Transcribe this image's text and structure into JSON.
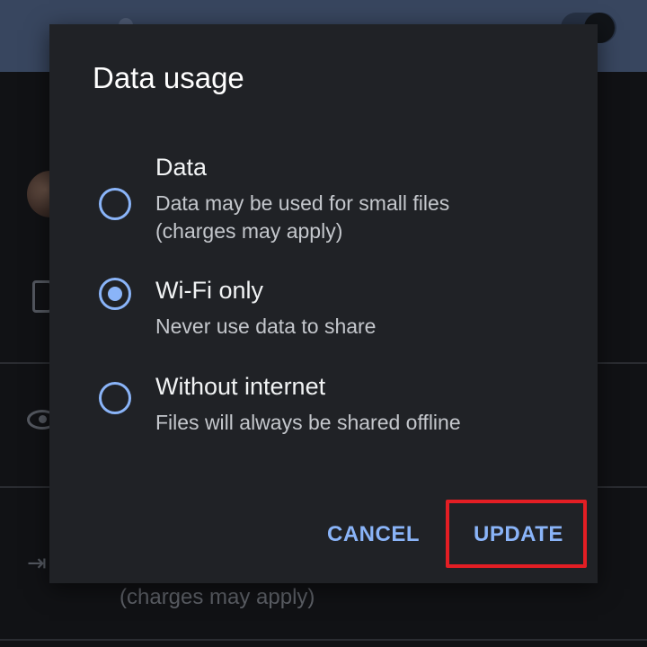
{
  "background": {
    "subtext": "(charges may apply)"
  },
  "dialog": {
    "title": "Data usage",
    "options": [
      {
        "title": "Data",
        "desc_line1": "Data may be used for small files",
        "desc_line2": "(charges may apply)",
        "selected": false
      },
      {
        "title": "Wi-Fi only",
        "desc_line1": "Never use data to share",
        "selected": true
      },
      {
        "title": "Without internet",
        "desc_line1": "Files will always be shared offline",
        "selected": false
      }
    ],
    "buttons": {
      "cancel": "CANCEL",
      "update": "UPDATE"
    }
  },
  "colors": {
    "accent": "#8ab4f8",
    "dialog_bg": "#202226",
    "highlight": "#e31e24",
    "appbar": "#38465f"
  },
  "icons": {
    "background": [
      "avatar",
      "phone-icon",
      "eye-icon",
      "arrow-icon"
    ]
  }
}
